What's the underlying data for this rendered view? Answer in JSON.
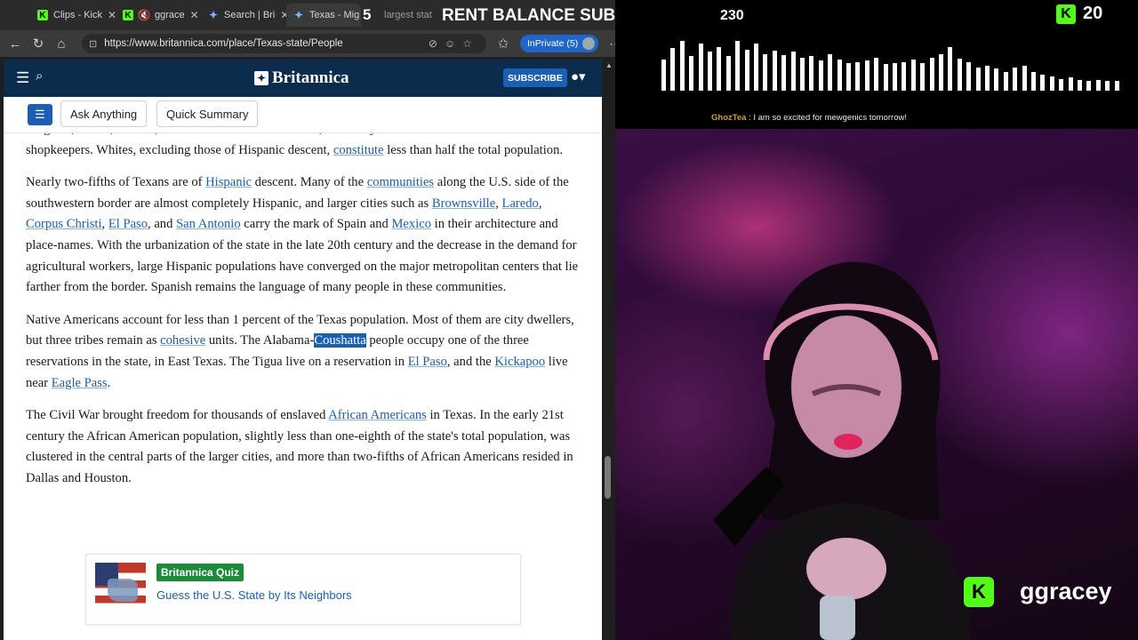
{
  "tabs": [
    {
      "label": "Clips - Kick",
      "favicon": "kick-icon"
    },
    {
      "label": "ggrace",
      "favicon": "kick-icon"
    },
    {
      "label": "Search | Bri",
      "favicon": "britannica-icon"
    },
    {
      "label": "Texas - Mig",
      "favicon": "britannica-icon"
    },
    {
      "label": "largest stat",
      "favicon": "search-icon"
    }
  ],
  "address_bar": {
    "url": "https://www.britannica.com/place/Texas-state/People",
    "inprivate_label": "InPrivate (5)"
  },
  "britannica": {
    "logo_text": "Britannica",
    "subscribe_label": "SUBSCRIBE",
    "ask_anything_label": "Ask Anything",
    "quick_summary_label": "Quick Summary"
  },
  "article": {
    "p0": {
      "t1": "Belgians, Danes, Italians, and Greeks also went to Texas, and many of them became craftsmen and shopkeepers. Whites, excluding those of Hispanic descent, ",
      "l1": "constitute",
      "t2": " less than half the total population."
    },
    "p1": {
      "t1": "Nearly two-fifths of Texans are of ",
      "l1": "Hispanic",
      "t2": " descent. Many of the ",
      "l2": "communities",
      "t3": " along the U.S. side of the southwestern border are almost completely Hispanic, and larger cities such as ",
      "l3": "Brownsville",
      "t4": ", ",
      "l4": "Laredo",
      "t5": ", ",
      "l5": "Corpus Christi",
      "t6": ", ",
      "l6": "El Paso",
      "t7": ", and ",
      "l7": "San Antonio",
      "t8": " carry the mark of Spain and ",
      "l8": "Mexico",
      "t9": " in their architecture and place-names. With the urbanization of the state in the late 20th century and the decrease in the demand for agricultural workers, large Hispanic populations have converged on the major metropolitan centers that lie farther from the border. Spanish remains the language of many people in these communities."
    },
    "p2": {
      "t1": "Native Americans account for less than 1 percent of the Texas population. Most of them are city dwellers, but three tribes remain as ",
      "l1": "cohesive",
      "t2": " units. The Alabama-",
      "hl": "Coushatta",
      "t3": " people occupy one of the three reservations in the state, in East Texas. The Tigua live on a reservation in ",
      "l2": "El Paso",
      "t4": ", and the ",
      "l3": "Kickapoo",
      "t5": " live near ",
      "l4": "Eagle Pass",
      "t6": "."
    },
    "p3": {
      "t1": "The Civil War brought freedom for thousands of enslaved ",
      "l1": "African Americans",
      "t2": " in Texas. In the early 21st century the African American population, slightly less than one-eighth of the state's total population, was clustered in the central parts of the larger cities, and more than two-fifths of African Americans resided in Dallas and Houston."
    }
  },
  "quiz": {
    "badge": "Britannica Quiz",
    "title": "Guess the U.S. State by Its Neighbors"
  },
  "stream": {
    "goal_count_left": "5",
    "goal_title": "RENT BALANCE SUB GOAL",
    "goal_count": "230",
    "kick_count": "20",
    "chat_user": "GhozTea",
    "chat_message": "I am so excited for mewgenics tomorrow!",
    "streamer_name": "ggracey",
    "audio_levels": [
      0.62,
      0.86,
      1.0,
      0.7,
      0.95,
      0.78,
      0.88,
      0.7,
      1.0,
      0.82,
      0.95,
      0.74,
      0.8,
      0.72,
      0.78,
      0.66,
      0.7,
      0.6,
      0.74,
      0.62,
      0.56,
      0.58,
      0.6,
      0.66,
      0.54,
      0.56,
      0.58,
      0.62,
      0.56,
      0.66,
      0.74,
      0.88,
      0.64,
      0.58,
      0.46,
      0.5,
      0.44,
      0.38,
      0.46,
      0.5,
      0.38,
      0.32,
      0.28,
      0.24,
      0.26,
      0.22,
      0.2,
      0.22,
      0.2,
      0.2
    ]
  }
}
